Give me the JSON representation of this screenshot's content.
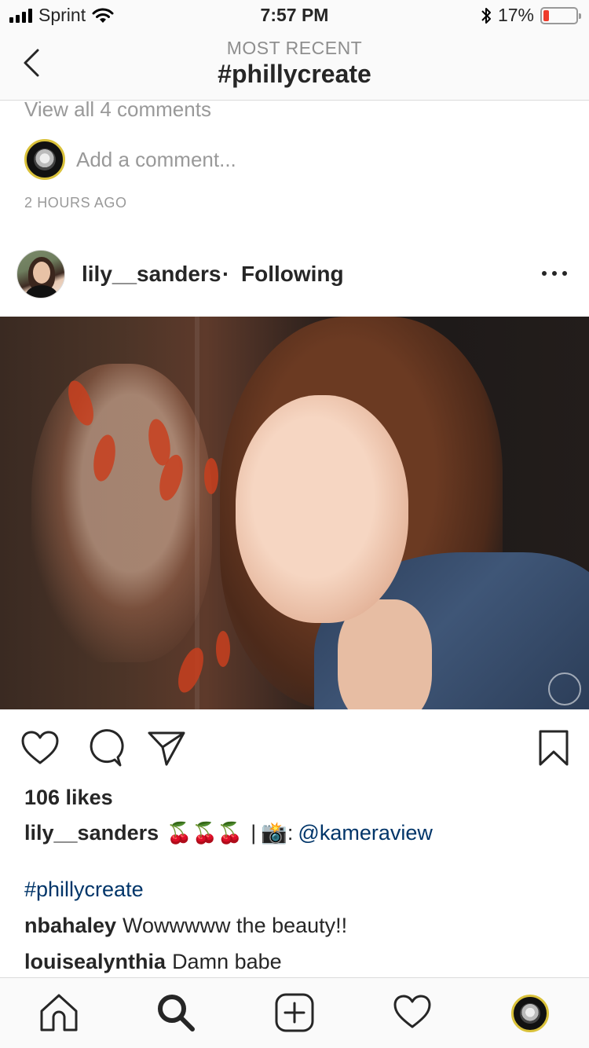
{
  "status_bar": {
    "carrier": "Sprint",
    "time": "7:57 PM",
    "battery_percent": "17%",
    "battery_level": 0.17,
    "icons": [
      "signal-icon",
      "wifi-icon",
      "bluetooth-icon",
      "battery-icon"
    ]
  },
  "header": {
    "subtitle": "MOST RECENT",
    "title": "#phillycreate"
  },
  "previous_post": {
    "view_all_comments": "View all 4 comments",
    "add_comment_placeholder": "Add a comment...",
    "timestamp": "2 HOURS AGO"
  },
  "post": {
    "username": "lily__sanders",
    "separator": "·",
    "follow_state": "Following",
    "likes": "106 likes",
    "caption_user": "lily__sanders",
    "caption_emojis": "🍒🍒🍒",
    "caption_pipe": "|",
    "caption_camera": "📸",
    "caption_colon": ":",
    "caption_mention": "@kameraview",
    "hashtag": "#phillycreate",
    "comments": [
      {
        "user": "nbahaley",
        "text": "Wowwwww the beauty!!"
      },
      {
        "user": "louisealynthia",
        "text": "Damn babe"
      }
    ]
  },
  "colors": {
    "link": "#003569",
    "battery_low": "#ee3b2b",
    "separator": "#dbdbdb",
    "muted_text": "#999999"
  }
}
